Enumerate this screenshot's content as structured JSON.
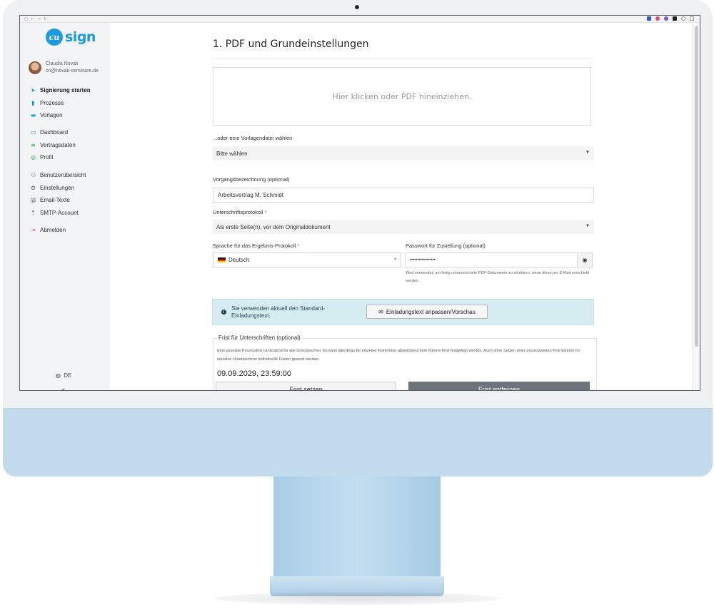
{
  "colors": {
    "brand": "#1b9be0",
    "info_bg": "#d5ecf1",
    "danger_button": "#6c737a",
    "required": "#d9534f"
  },
  "sidebar": {
    "logo_text": "sign",
    "user": {
      "name": "Claudia Novak",
      "email": "cn@novak-seminare.de"
    },
    "groups": [
      [
        {
          "label": "Signierung starten",
          "icon": "send-icon",
          "active": true
        },
        {
          "label": "Prozesse",
          "icon": "file-icon"
        },
        {
          "label": "Vorlagen",
          "icon": "folder-icon"
        }
      ],
      [
        {
          "label": "Dashboard",
          "icon": "dashboard-icon"
        },
        {
          "label": "Vertragsdaten",
          "icon": "sliders-icon"
        },
        {
          "label": "Profil",
          "icon": "profile-icon"
        }
      ],
      [
        {
          "label": "Benutzerübersicht",
          "icon": "users-icon"
        },
        {
          "label": "Einstellungen",
          "icon": "settings-icon"
        },
        {
          "label": "Email-Texte",
          "icon": "at-icon"
        },
        {
          "label": "SMTP-Account",
          "icon": "upload-icon"
        }
      ],
      [
        {
          "label": "Abmelden",
          "icon": "logout-icon"
        }
      ]
    ],
    "language": "DE",
    "collapse": "«"
  },
  "main": {
    "title": "1. PDF und Grundeinstellungen",
    "dropzone_text": "Hier klicken oder PDF hineinziehen.",
    "template_label": "...oder eine Vorlagendatei wählen",
    "template_value": "Bitte wählen",
    "process_label": "Vorgangsbezeichnung (optional)",
    "process_value": "Arbeitsvertrag M. Schmidt",
    "protocol_label": "Unterschriftsprotokoll",
    "protocol_value": "Als erste Seite(n), vor dem Originaldokument",
    "language_label": "Sprache für das Ergebnis-Protokoll",
    "language_value": "Deutsch",
    "password_label": "Passwort für Zustellung (optional)",
    "password_value": "•••••••••••••••••",
    "password_hint": "Wird verwendet, um fertig unterzeichnete PDF-Dokumente zu schützen, wenn diese per E-Mail verschickt werden.",
    "required_mark": "*",
    "info_text": "Sie verwenden aktuell den Standard-Einladungstext.",
    "invitation_button": "Einladungstext anpassen/Vorschau",
    "deadline_legend": "Frist für Unterschriften (optional)",
    "deadline_desc": "Eine gesetzte Prozessfrist ist bindend für alle Unterzeichner. Es kann allerdings für einzelne Teilnehmer abweichend eine frühere Frist festgelegt werden. Auch ohne Setzen einer prozessweiten Frist können für einzelne Unterzeichner individuelle Fristen gesetzt werden.",
    "deadline_value": "09.09.2029, 23:59:00",
    "set_button": "Frist setzen",
    "remove_button": "Frist entfernen"
  }
}
